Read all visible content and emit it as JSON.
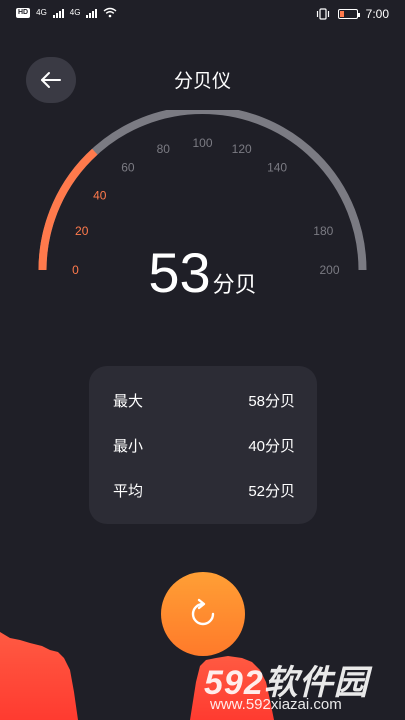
{
  "status_bar": {
    "hd_label": "HD",
    "net_label_1": "4G",
    "net_label_2": "4G",
    "time": "7:00",
    "battery_level": 0.3
  },
  "header": {
    "title": "分贝仪",
    "back_icon": "arrow-left-icon"
  },
  "meter": {
    "value": "53",
    "unit": "分贝",
    "min": 0,
    "max": 200,
    "ticks": [
      "0",
      "20",
      "40",
      "60",
      "80",
      "100",
      "120",
      "140",
      "180",
      "200"
    ],
    "accent_color": "#ff7a4c",
    "track_color": "#7b7b83"
  },
  "stats": [
    {
      "label": "最大",
      "value": "58分贝"
    },
    {
      "label": "最小",
      "value": "40分贝"
    },
    {
      "label": "平均",
      "value": "52分贝"
    }
  ],
  "reset": {
    "icon": "refresh-icon",
    "color": "#ff8c30"
  },
  "watermark": {
    "brand": "592软件园",
    "url": "www.592xiazai.com"
  }
}
